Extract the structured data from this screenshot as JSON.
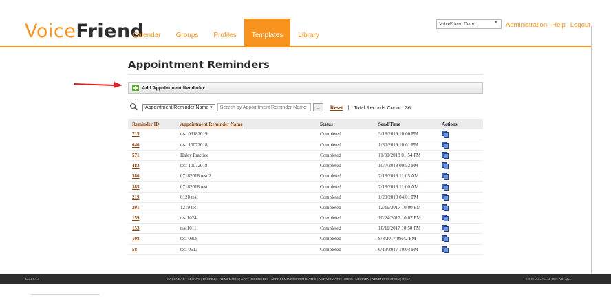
{
  "logo": {
    "part1": "Voice",
    "part2": "Friend"
  },
  "nav": [
    {
      "label": "Calendar",
      "active": false
    },
    {
      "label": "Groups",
      "active": false
    },
    {
      "label": "Profiles",
      "active": false
    },
    {
      "label": "Templates",
      "active": true
    },
    {
      "label": "Library",
      "active": false
    }
  ],
  "account_select": {
    "value": "VoiceFriend Demo"
  },
  "top_links": [
    "Administration",
    "Help",
    "Logout"
  ],
  "page_title": "Appointment Reminders",
  "add_button": {
    "label": "Add Appointment Reminder"
  },
  "search": {
    "field_value": "Appointment Reminder Name",
    "placeholder": "Search by Appointment Reminder Name",
    "go_label": "→",
    "reset_label": "Reset",
    "separator": "|",
    "total_text": "Total Records Count : 36"
  },
  "table": {
    "headers": [
      "Reminder ID",
      "Appointment Reminder Name",
      "Status",
      "Send Time",
      "Actions"
    ],
    "rows": [
      {
        "id": "715",
        "name": "test 03182019",
        "status": "Completed",
        "time": "3/18/2019 10:00 PM"
      },
      {
        "id": "646",
        "name": "test 10072018",
        "status": "Completed",
        "time": "1/30/2019 10:01 PM"
      },
      {
        "id": "571",
        "name": "Haley Practice",
        "status": "Completed",
        "time": "11/30/2018 01:54 PM"
      },
      {
        "id": "483",
        "name": "test 10072018",
        "status": "Completed",
        "time": "10/7/2018 09:52 PM"
      },
      {
        "id": "386",
        "name": "07182018 test 2",
        "status": "Completed",
        "time": "7/18/2018 11:05 AM"
      },
      {
        "id": "385",
        "name": "07182018 test",
        "status": "Completed",
        "time": "7/18/2018 11:00 AM"
      },
      {
        "id": "219",
        "name": "0120 test",
        "status": "Completed",
        "time": "1/20/2018 04:01 PM"
      },
      {
        "id": "201",
        "name": "1219 test",
        "status": "Completed",
        "time": "12/19/2017 10:00 PM"
      },
      {
        "id": "159",
        "name": "test1024",
        "status": "Completed",
        "time": "10/24/2017 10:07 PM"
      },
      {
        "id": "153",
        "name": "test1011",
        "status": "Completed",
        "time": "10/11/2017 10:50 PM"
      },
      {
        "id": "108",
        "name": "test 0808",
        "status": "Completed",
        "time": "8/8/2017 09:42 PM"
      },
      {
        "id": "58",
        "name": "test 0613",
        "status": "Completed",
        "time": "6/13/2017 10:04 PM"
      }
    ]
  },
  "footer": {
    "build": "build 1.3.4",
    "links": "CALENDAR | GROUPS | PROFILES | TEMPLATES | APPT REMINDERS | APPT REMINDER TEMPLATES | ACTIVITY ATTENDEES | LIBRARY | ADMINISTRATION | HELP",
    "copyright": "©2019 VoiceFriend, LLC. All rights"
  },
  "colors": {
    "brand": "#f7931e",
    "link": "#8b4513",
    "footer_bg": "#2d2d2d"
  }
}
